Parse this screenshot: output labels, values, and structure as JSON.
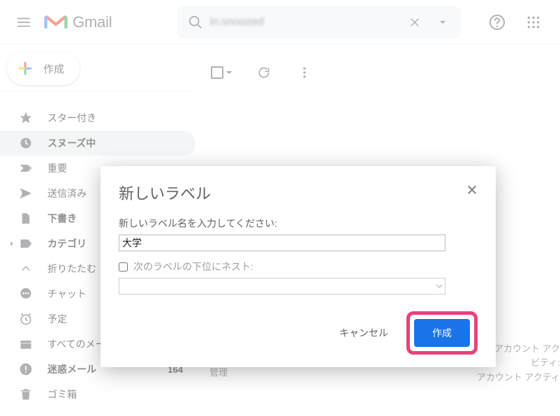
{
  "header": {
    "product": "Gmail",
    "search_value": "in:snoozed"
  },
  "compose_label": "作成",
  "sidebar": {
    "items": [
      {
        "label": "スター付き",
        "icon": "star",
        "bold": false
      },
      {
        "label": "スヌーズ中",
        "icon": "clock",
        "bold": true,
        "active": true
      },
      {
        "label": "重要",
        "icon": "tag-dbl",
        "bold": false
      },
      {
        "label": "送信済み",
        "icon": "send",
        "bold": false
      },
      {
        "label": "下書き",
        "icon": "file",
        "bold": true
      },
      {
        "label": "カテゴリ",
        "icon": "tag-filled",
        "bold": true,
        "caret": true
      },
      {
        "label": "折りたたむ",
        "icon": "chevron-up",
        "bold": false
      },
      {
        "label": "チャット",
        "icon": "chat",
        "bold": false
      },
      {
        "label": "予定",
        "icon": "clock-alarm",
        "bold": false
      },
      {
        "label": "すべてのメール",
        "icon": "stack",
        "bold": false
      },
      {
        "label": "迷惑メール",
        "icon": "alert",
        "bold": true,
        "count": "164"
      },
      {
        "label": "ゴミ箱",
        "icon": "trash",
        "bold": false
      }
    ]
  },
  "footer": {
    "mid": "管理",
    "r1": "のアカウント アク",
    "r2": "ビティ:",
    "r3": "アカウント アクティ"
  },
  "dialog": {
    "title": "新しいラベル",
    "subtitle": "新しいラベル名を入力してください:",
    "input_value": "大学",
    "nest_label": "次のラベルの下位にネスト:",
    "cancel": "キャンセル",
    "create": "作成"
  }
}
